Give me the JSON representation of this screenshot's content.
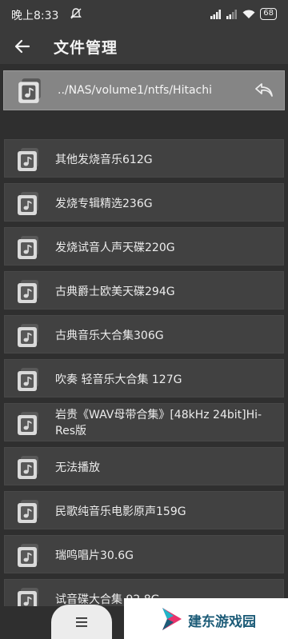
{
  "status_bar": {
    "time": "晚上8:33",
    "battery": "68",
    "icons": [
      "muted-notification-icon",
      "signal-icon",
      "signal-icon",
      "wifi-icon",
      "battery-icon"
    ]
  },
  "app_bar": {
    "title": "文件管理",
    "back_icon": "back-arrow-icon"
  },
  "list": {
    "current_path": "../NAS/volume1/ntfs/Hitachi",
    "return_icon": "return-arrow-icon",
    "items": [
      {
        "label": "其他发烧音乐612G",
        "icon": "music-folder-icon"
      },
      {
        "label": "发烧专辑精选236G",
        "icon": "music-folder-icon"
      },
      {
        "label": "发烧试音人声天碟220G",
        "icon": "music-folder-icon"
      },
      {
        "label": "古典爵士欧美天碟294G",
        "icon": "music-folder-icon"
      },
      {
        "label": "古典音乐大合集306G",
        "icon": "music-folder-icon"
      },
      {
        "label": "吹奏 轻音乐大合集 127G",
        "icon": "music-folder-icon"
      },
      {
        "label": "岩贵《WAV母带合集》[48kHz 24bit]Hi-Res版",
        "icon": "music-folder-icon"
      },
      {
        "label": "无法播放",
        "icon": "music-folder-icon"
      },
      {
        "label": "民歌纯音乐电影原声159G",
        "icon": "music-folder-icon"
      },
      {
        "label": "瑞鸣唱片30.6G",
        "icon": "music-folder-icon"
      },
      {
        "label": "试音碟大合集 92.8G",
        "icon": "music-folder-icon"
      }
    ]
  },
  "bottom": {
    "menu_icon": "hamburger-menu-icon",
    "watermark_text": "建东游戏园",
    "watermark_colors": [
      "#1d5c78",
      "#e8336d",
      "#21b5c8"
    ]
  }
}
